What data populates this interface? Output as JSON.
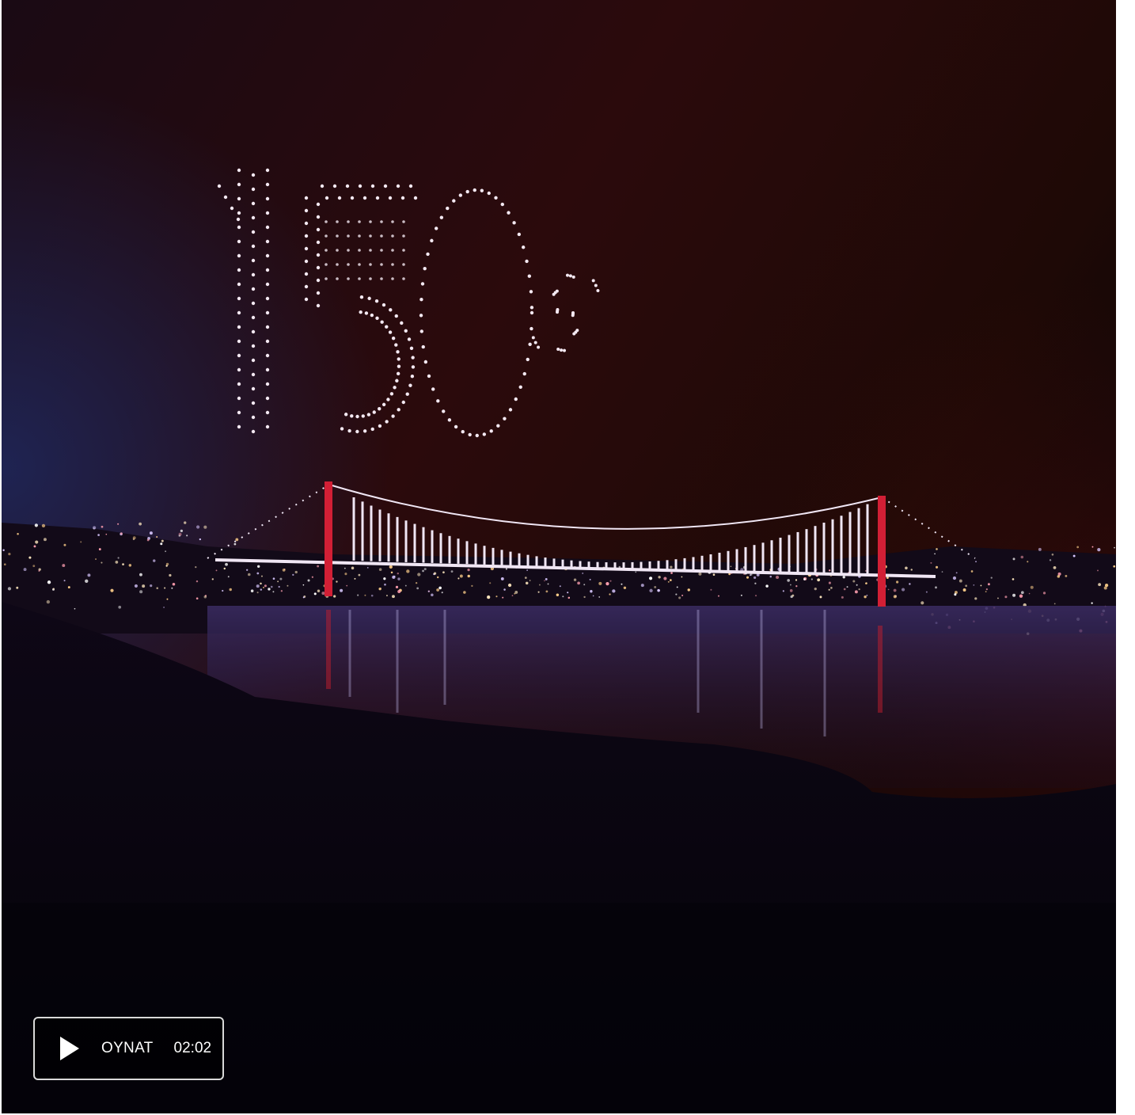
{
  "video": {
    "play_label": "OYNAT",
    "duration": "02:02",
    "play_icon": "play-icon"
  }
}
